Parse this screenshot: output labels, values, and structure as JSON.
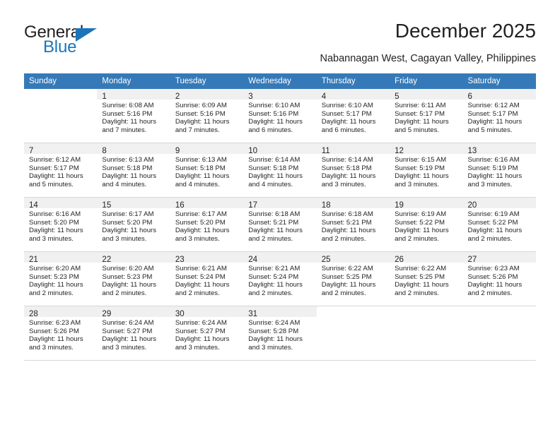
{
  "brand": {
    "name_part1": "General",
    "name_part2": "Blue",
    "triangle_color": "#1b75bb",
    "text_color": "#231f20"
  },
  "header": {
    "title": "December 2025",
    "subtitle": "Nabannagan West, Cagayan Valley, Philippines"
  },
  "theme": {
    "header_row_bg": "#3579b8",
    "header_row_text": "#ffffff",
    "daynum_bar_bg": "#f0f0f0",
    "row_border": "#d7d7d7"
  },
  "weekday_headers": [
    "Sunday",
    "Monday",
    "Tuesday",
    "Wednesday",
    "Thursday",
    "Friday",
    "Saturday"
  ],
  "weeks": [
    [
      {
        "day": "",
        "sunrise": "",
        "sunset": "",
        "daylight1": "",
        "daylight2": ""
      },
      {
        "day": "1",
        "sunrise": "Sunrise: 6:08 AM",
        "sunset": "Sunset: 5:16 PM",
        "daylight1": "Daylight: 11 hours",
        "daylight2": "and 7 minutes."
      },
      {
        "day": "2",
        "sunrise": "Sunrise: 6:09 AM",
        "sunset": "Sunset: 5:16 PM",
        "daylight1": "Daylight: 11 hours",
        "daylight2": "and 7 minutes."
      },
      {
        "day": "3",
        "sunrise": "Sunrise: 6:10 AM",
        "sunset": "Sunset: 5:16 PM",
        "daylight1": "Daylight: 11 hours",
        "daylight2": "and 6 minutes."
      },
      {
        "day": "4",
        "sunrise": "Sunrise: 6:10 AM",
        "sunset": "Sunset: 5:17 PM",
        "daylight1": "Daylight: 11 hours",
        "daylight2": "and 6 minutes."
      },
      {
        "day": "5",
        "sunrise": "Sunrise: 6:11 AM",
        "sunset": "Sunset: 5:17 PM",
        "daylight1": "Daylight: 11 hours",
        "daylight2": "and 5 minutes."
      },
      {
        "day": "6",
        "sunrise": "Sunrise: 6:12 AM",
        "sunset": "Sunset: 5:17 PM",
        "daylight1": "Daylight: 11 hours",
        "daylight2": "and 5 minutes."
      }
    ],
    [
      {
        "day": "7",
        "sunrise": "Sunrise: 6:12 AM",
        "sunset": "Sunset: 5:17 PM",
        "daylight1": "Daylight: 11 hours",
        "daylight2": "and 5 minutes."
      },
      {
        "day": "8",
        "sunrise": "Sunrise: 6:13 AM",
        "sunset": "Sunset: 5:18 PM",
        "daylight1": "Daylight: 11 hours",
        "daylight2": "and 4 minutes."
      },
      {
        "day": "9",
        "sunrise": "Sunrise: 6:13 AM",
        "sunset": "Sunset: 5:18 PM",
        "daylight1": "Daylight: 11 hours",
        "daylight2": "and 4 minutes."
      },
      {
        "day": "10",
        "sunrise": "Sunrise: 6:14 AM",
        "sunset": "Sunset: 5:18 PM",
        "daylight1": "Daylight: 11 hours",
        "daylight2": "and 4 minutes."
      },
      {
        "day": "11",
        "sunrise": "Sunrise: 6:14 AM",
        "sunset": "Sunset: 5:18 PM",
        "daylight1": "Daylight: 11 hours",
        "daylight2": "and 3 minutes."
      },
      {
        "day": "12",
        "sunrise": "Sunrise: 6:15 AM",
        "sunset": "Sunset: 5:19 PM",
        "daylight1": "Daylight: 11 hours",
        "daylight2": "and 3 minutes."
      },
      {
        "day": "13",
        "sunrise": "Sunrise: 6:16 AM",
        "sunset": "Sunset: 5:19 PM",
        "daylight1": "Daylight: 11 hours",
        "daylight2": "and 3 minutes."
      }
    ],
    [
      {
        "day": "14",
        "sunrise": "Sunrise: 6:16 AM",
        "sunset": "Sunset: 5:20 PM",
        "daylight1": "Daylight: 11 hours",
        "daylight2": "and 3 minutes."
      },
      {
        "day": "15",
        "sunrise": "Sunrise: 6:17 AM",
        "sunset": "Sunset: 5:20 PM",
        "daylight1": "Daylight: 11 hours",
        "daylight2": "and 3 minutes."
      },
      {
        "day": "16",
        "sunrise": "Sunrise: 6:17 AM",
        "sunset": "Sunset: 5:20 PM",
        "daylight1": "Daylight: 11 hours",
        "daylight2": "and 3 minutes."
      },
      {
        "day": "17",
        "sunrise": "Sunrise: 6:18 AM",
        "sunset": "Sunset: 5:21 PM",
        "daylight1": "Daylight: 11 hours",
        "daylight2": "and 2 minutes."
      },
      {
        "day": "18",
        "sunrise": "Sunrise: 6:18 AM",
        "sunset": "Sunset: 5:21 PM",
        "daylight1": "Daylight: 11 hours",
        "daylight2": "and 2 minutes."
      },
      {
        "day": "19",
        "sunrise": "Sunrise: 6:19 AM",
        "sunset": "Sunset: 5:22 PM",
        "daylight1": "Daylight: 11 hours",
        "daylight2": "and 2 minutes."
      },
      {
        "day": "20",
        "sunrise": "Sunrise: 6:19 AM",
        "sunset": "Sunset: 5:22 PM",
        "daylight1": "Daylight: 11 hours",
        "daylight2": "and 2 minutes."
      }
    ],
    [
      {
        "day": "21",
        "sunrise": "Sunrise: 6:20 AM",
        "sunset": "Sunset: 5:23 PM",
        "daylight1": "Daylight: 11 hours",
        "daylight2": "and 2 minutes."
      },
      {
        "day": "22",
        "sunrise": "Sunrise: 6:20 AM",
        "sunset": "Sunset: 5:23 PM",
        "daylight1": "Daylight: 11 hours",
        "daylight2": "and 2 minutes."
      },
      {
        "day": "23",
        "sunrise": "Sunrise: 6:21 AM",
        "sunset": "Sunset: 5:24 PM",
        "daylight1": "Daylight: 11 hours",
        "daylight2": "and 2 minutes."
      },
      {
        "day": "24",
        "sunrise": "Sunrise: 6:21 AM",
        "sunset": "Sunset: 5:24 PM",
        "daylight1": "Daylight: 11 hours",
        "daylight2": "and 2 minutes."
      },
      {
        "day": "25",
        "sunrise": "Sunrise: 6:22 AM",
        "sunset": "Sunset: 5:25 PM",
        "daylight1": "Daylight: 11 hours",
        "daylight2": "and 2 minutes."
      },
      {
        "day": "26",
        "sunrise": "Sunrise: 6:22 AM",
        "sunset": "Sunset: 5:25 PM",
        "daylight1": "Daylight: 11 hours",
        "daylight2": "and 2 minutes."
      },
      {
        "day": "27",
        "sunrise": "Sunrise: 6:23 AM",
        "sunset": "Sunset: 5:26 PM",
        "daylight1": "Daylight: 11 hours",
        "daylight2": "and 2 minutes."
      }
    ],
    [
      {
        "day": "28",
        "sunrise": "Sunrise: 6:23 AM",
        "sunset": "Sunset: 5:26 PM",
        "daylight1": "Daylight: 11 hours",
        "daylight2": "and 3 minutes."
      },
      {
        "day": "29",
        "sunrise": "Sunrise: 6:24 AM",
        "sunset": "Sunset: 5:27 PM",
        "daylight1": "Daylight: 11 hours",
        "daylight2": "and 3 minutes."
      },
      {
        "day": "30",
        "sunrise": "Sunrise: 6:24 AM",
        "sunset": "Sunset: 5:27 PM",
        "daylight1": "Daylight: 11 hours",
        "daylight2": "and 3 minutes."
      },
      {
        "day": "31",
        "sunrise": "Sunrise: 6:24 AM",
        "sunset": "Sunset: 5:28 PM",
        "daylight1": "Daylight: 11 hours",
        "daylight2": "and 3 minutes."
      },
      {
        "day": "",
        "sunrise": "",
        "sunset": "",
        "daylight1": "",
        "daylight2": ""
      },
      {
        "day": "",
        "sunrise": "",
        "sunset": "",
        "daylight1": "",
        "daylight2": ""
      },
      {
        "day": "",
        "sunrise": "",
        "sunset": "",
        "daylight1": "",
        "daylight2": ""
      }
    ]
  ]
}
